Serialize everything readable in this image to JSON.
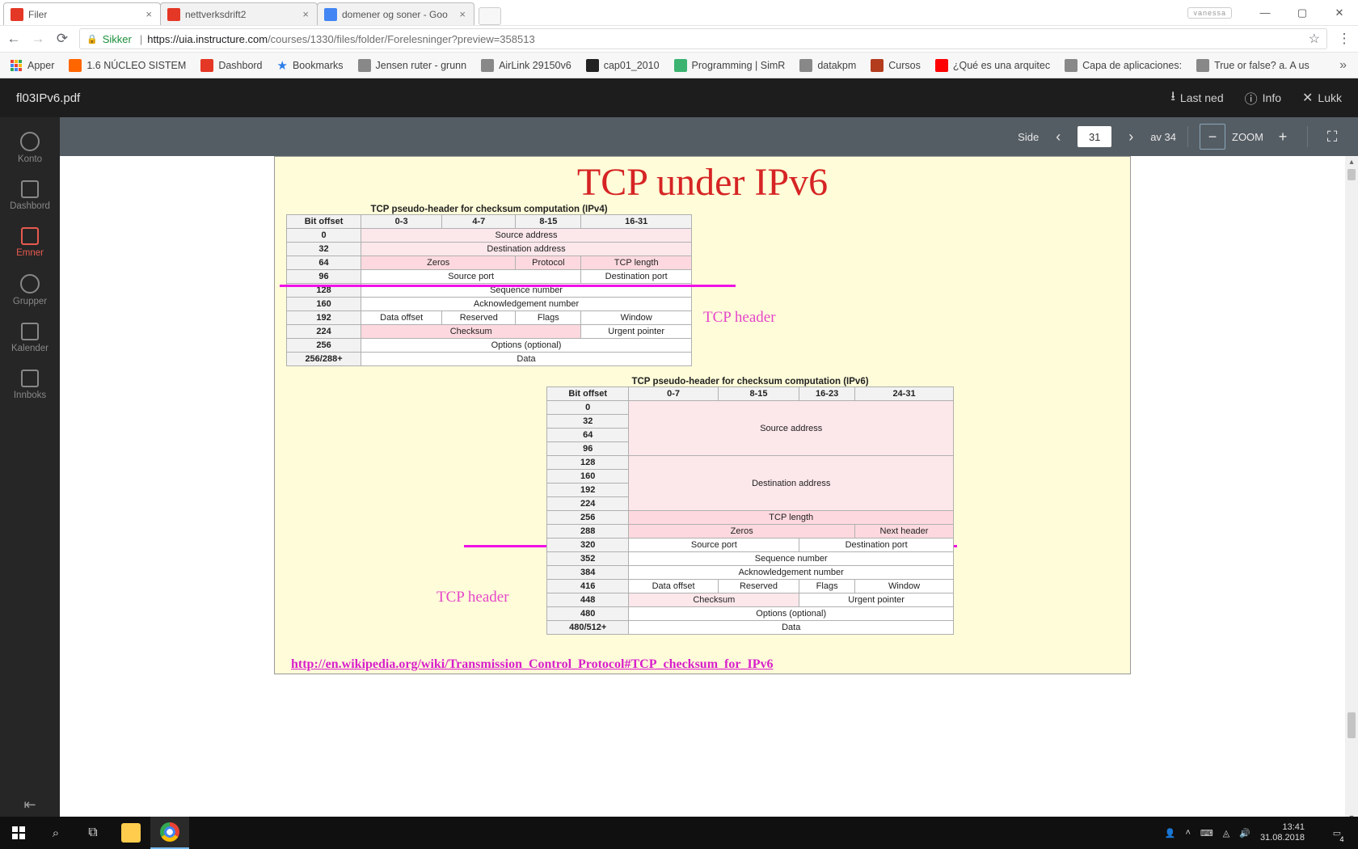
{
  "window": {
    "user_badge": "vanessa"
  },
  "tabs": [
    {
      "title": "Filer",
      "icon": "#e43725",
      "active": true
    },
    {
      "title": "nettverksdrift2",
      "icon": "#e43725",
      "active": false
    },
    {
      "title": "domener og soner - Goo",
      "icon": "#4285f4",
      "active": false
    }
  ],
  "omnibox": {
    "secure": "Sikker",
    "host": "https://uia.instructure.com",
    "path": "/courses/1330/files/folder/Forelesninger?preview=358513"
  },
  "bookmarks": [
    {
      "t": "Apper",
      "c": "#4285f4",
      "grid": true
    },
    {
      "t": "1.6 NÚCLEO SISTEM",
      "c": "#ff6600"
    },
    {
      "t": "Dashbord",
      "c": "#e43725"
    },
    {
      "t": "Bookmarks",
      "c": "#2b7de9",
      "star": true
    },
    {
      "t": "Jensen ruter - grunn",
      "c": "#888"
    },
    {
      "t": "AirLink 29150v6",
      "c": "#888"
    },
    {
      "t": "cap01_2010",
      "c": "#222"
    },
    {
      "t": "Programming | SimR",
      "c": "#3cb371"
    },
    {
      "t": "datakpm",
      "c": "#888"
    },
    {
      "t": "Cursos",
      "c": "#b33c1e"
    },
    {
      "t": "¿Qué es una arquitec",
      "c": "#ff0000"
    },
    {
      "t": "Capa de aplicaciones:",
      "c": "#888"
    },
    {
      "t": "True or false? a. A us",
      "c": "#888"
    }
  ],
  "viewer": {
    "filename": "fl03IPv6.pdf",
    "download": "Last ned",
    "info": "Info",
    "close": "Lukk",
    "page_label": "Side",
    "page_current": "31",
    "page_total": "av 34",
    "zoom_label": "ZOOM"
  },
  "rail": [
    {
      "l": "Konto",
      "active": false,
      "shape": "circle"
    },
    {
      "l": "Dashbord",
      "active": false,
      "shape": "sq"
    },
    {
      "l": "Emner",
      "active": true,
      "shape": "sq"
    },
    {
      "l": "Grupper",
      "active": false,
      "shape": "circle"
    },
    {
      "l": "Kalender",
      "active": false,
      "shape": "sq"
    },
    {
      "l": "Innboks",
      "active": false,
      "shape": "sq"
    }
  ],
  "slide": {
    "title": "TCP under IPv6",
    "cap4": "TCP pseudo-header for checksum computation (IPv4)",
    "cap6": "TCP pseudo-header for checksum computation (IPv6)",
    "lbl": "TCP header",
    "src": "http://en.wikipedia.org/wiki/Transmission_Control_Protocol#TCP_checksum_for_IPv6",
    "h4": [
      "Bit offset",
      "0-3",
      "4-7",
      "8-15",
      "16-31"
    ],
    "r4": [
      {
        "off": "0",
        "span": "Source address",
        "cls": "lpink"
      },
      {
        "off": "32",
        "span": "Destination address",
        "cls": "lpink"
      },
      {
        "off": "64",
        "c": [
          "Zeros",
          "Protocol",
          "TCP length"
        ],
        "cls": "pink"
      },
      {
        "off": "96",
        "c2": [
          "Source port",
          "Destination port"
        ]
      },
      {
        "off": "128",
        "span": "Sequence number"
      },
      {
        "off": "160",
        "span": "Acknowledgement number"
      },
      {
        "off": "192",
        "c4": [
          "Data offset",
          "Reserved",
          "Flags",
          "Window"
        ]
      },
      {
        "off": "224",
        "c2": [
          "Checksum",
          "Urgent pointer"
        ],
        "cls0": "pink"
      },
      {
        "off": "256",
        "span": "Options (optional)"
      },
      {
        "off": "256/288+",
        "span": "Data"
      }
    ],
    "h6": [
      "Bit offset",
      "0-7",
      "8-15",
      "16-23",
      "24-31"
    ],
    "src6": [
      [
        "0",
        "32",
        "64",
        "96"
      ],
      "Source address",
      "lpink"
    ],
    "dst6": [
      [
        "128",
        "160",
        "192",
        "224"
      ],
      "Destination address",
      "lpink"
    ],
    "r6": [
      {
        "off": "256",
        "span": "TCP length",
        "cls": "pink"
      },
      {
        "off": "288",
        "c": [
          "Zeros",
          "Next header"
        ],
        "sp": [
          3,
          1
        ],
        "cls": "pink"
      },
      {
        "off": "320",
        "c": [
          "Source port",
          "Destination port"
        ],
        "sp": [
          2,
          2
        ]
      },
      {
        "off": "352",
        "span": "Sequence number"
      },
      {
        "off": "384",
        "span": "Acknowledgement number"
      },
      {
        "off": "416",
        "c": [
          "Data offset",
          "Reserved",
          "Flags",
          "Window"
        ],
        "sp": [
          1,
          1,
          1,
          1
        ]
      },
      {
        "off": "448",
        "c": [
          "Checksum",
          "Urgent pointer"
        ],
        "sp": [
          2,
          2
        ],
        "cls0": "lpink"
      },
      {
        "off": "480",
        "span": "Options (optional)"
      },
      {
        "off": "480/512+",
        "span": "Data"
      }
    ]
  },
  "taskbar": {
    "time": "13:41",
    "date": "31.08.2018",
    "notif_count": "4"
  }
}
